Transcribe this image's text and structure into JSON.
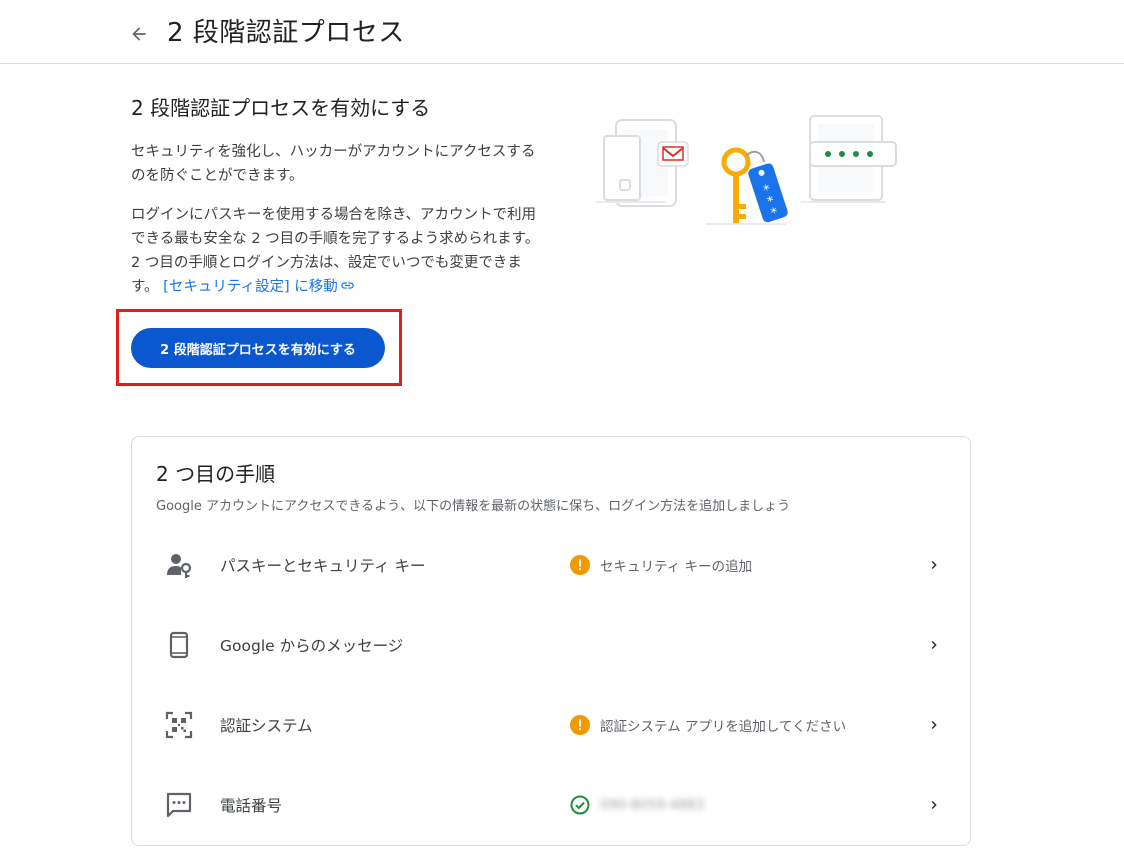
{
  "header": {
    "title": "2 段階認証プロセス",
    "back_icon": "arrow-back-icon"
  },
  "intro": {
    "heading": "2 段階認証プロセスを有効にする",
    "paragraph1": "セキュリティを強化し、ハッカーがアカウントにアクセスするのを防ぐことができます。",
    "paragraph2": "ログインにパスキーを使用する場合を除き、アカウントで利用できる最も安全な 2 つ目の手順を完了するよう求められます。2 つ目の手順とログイン方法は、設定でいつでも変更できます。",
    "link_text": "[セキュリティ設定] に移動",
    "link_icon": "link-icon",
    "button_label": "2 段階認証プロセスを有効にする"
  },
  "second_step": {
    "title": "2 つ目の手順",
    "subtitle": "Google アカウントにアクセスできるよう、以下の情報を最新の状態に保ち、ログイン方法を追加しましょう",
    "items": [
      {
        "label": "パスキーとセキュリティ キー",
        "icon": "person-key-icon",
        "status": "セキュリティ キーの追加",
        "status_icon": "warning-icon"
      },
      {
        "label": "Google からのメッセージ",
        "icon": "smartphone-icon",
        "status": "",
        "status_icon": ""
      },
      {
        "label": "認証システム",
        "icon": "qr-code-icon",
        "status": "認証システム アプリを追加してください",
        "status_icon": "warning-icon"
      },
      {
        "label": "電話番号",
        "icon": "sms-icon",
        "status": "090-8059-4883",
        "status_icon": "check-circle-icon"
      }
    ]
  },
  "colors": {
    "primary": "#0b57d0",
    "link": "#1a73e8",
    "warning": "#f29900",
    "success": "#1e8e3e",
    "highlight": "#e41c1c"
  }
}
